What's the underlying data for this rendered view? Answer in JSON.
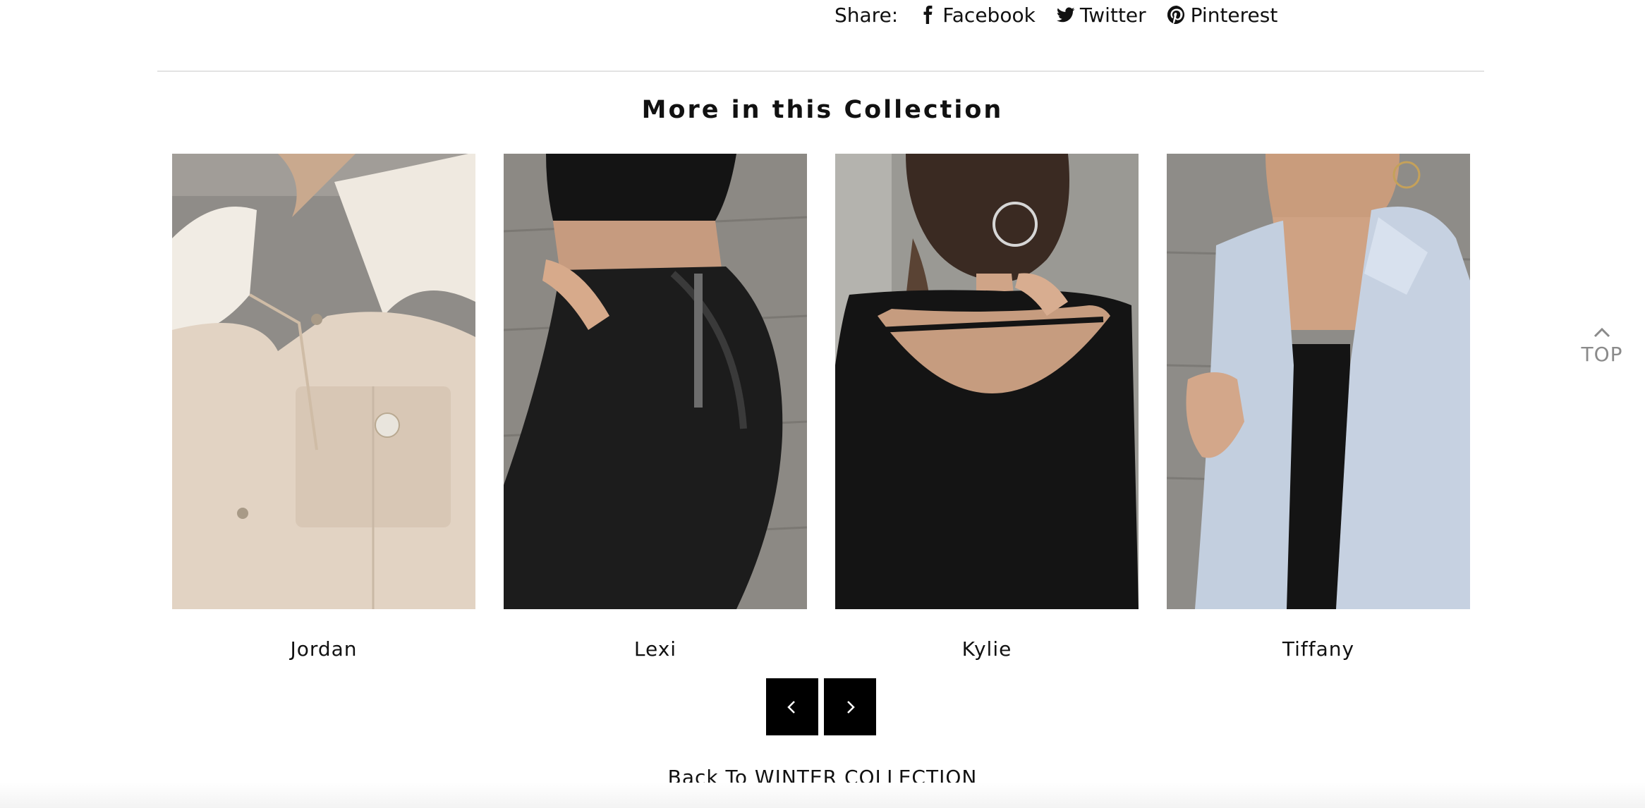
{
  "share": {
    "label": "Share:",
    "links": [
      {
        "label": "Facebook",
        "icon": "facebook-icon"
      },
      {
        "label": "Twitter",
        "icon": "twitter-icon"
      },
      {
        "label": "Pinterest",
        "icon": "pinterest-icon"
      }
    ]
  },
  "collection": {
    "title": "More in this Collection",
    "products": [
      {
        "name": "Jordan"
      },
      {
        "name": "Lexi"
      },
      {
        "name": "Kylie"
      },
      {
        "name": "Tiffany"
      }
    ],
    "prev_icon": "chevron-left-icon",
    "next_icon": "chevron-right-icon"
  },
  "back_link": "Back To WINTER COLLECTION",
  "top_button": {
    "label": "TOP",
    "icon": "chevron-up-icon"
  },
  "colors": {
    "button_bg": "#000000",
    "top_button": "#8a8a8a",
    "divider": "#e3e3e3"
  }
}
